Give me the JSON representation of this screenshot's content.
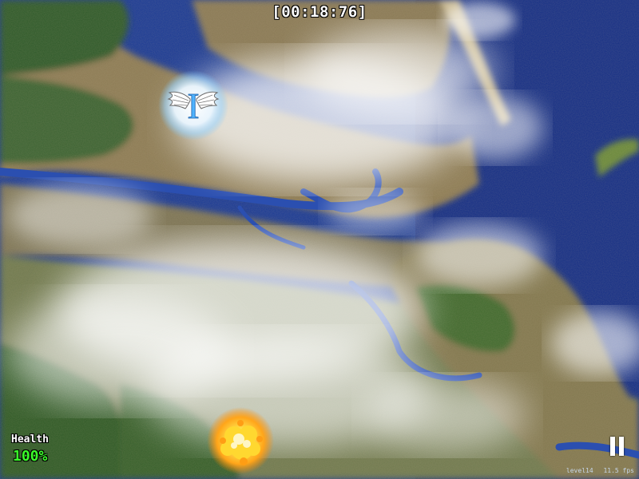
{
  "hud": {
    "timer": "[00:18:76]",
    "health_label": "Health",
    "health_value": "100%",
    "health_fraction": 1.0,
    "pause_icon": "pause-icon",
    "debug": {
      "left": "level14",
      "right": "11.5 fps"
    }
  },
  "game_objects": {
    "player": {
      "icon": "winged-letter-I-icon",
      "letter": "I"
    },
    "explosion": {
      "icon": "explosion-icon"
    }
  },
  "colors": {
    "ocean": "#1e3f9c",
    "land": "#9a8a5a",
    "forest": "#3a6b2a",
    "health_green": "#3bff2a",
    "hud_text": "#ffffff"
  }
}
